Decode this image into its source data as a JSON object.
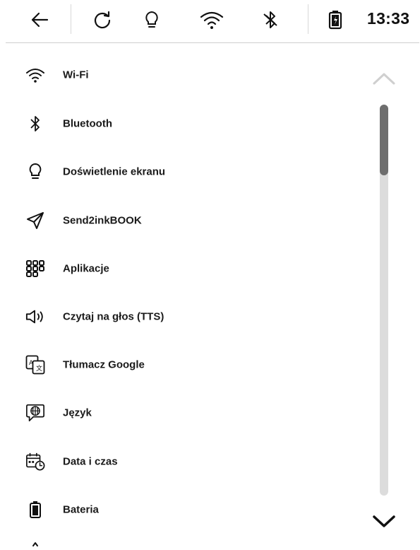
{
  "status_bar": {
    "time": "13:33",
    "icons": [
      "back-arrow-icon",
      "sync-icon",
      "lightbulb-icon",
      "wifi-icon",
      "bluetooth-off-icon",
      "battery-charging-icon"
    ]
  },
  "settings_menu": {
    "items": [
      {
        "label": "Wi-Fi",
        "icon": "wifi-icon"
      },
      {
        "label": "Bluetooth",
        "icon": "bluetooth-icon"
      },
      {
        "label": "Doświetlenie ekranu",
        "icon": "lightbulb-icon"
      },
      {
        "label": "Send2inkBOOK",
        "icon": "send-icon"
      },
      {
        "label": "Aplikacje",
        "icon": "apps-grid-icon"
      },
      {
        "label": "Czytaj na głos (TTS)",
        "icon": "speaker-icon"
      },
      {
        "label": "Tłumacz Google",
        "icon": "translate-icon"
      },
      {
        "label": "Język",
        "icon": "language-globe-icon"
      },
      {
        "label": "Data i czas",
        "icon": "calendar-clock-icon"
      },
      {
        "label": "Bateria",
        "icon": "battery-icon"
      }
    ]
  },
  "scrollbar": {
    "thumb_fraction": 0.18,
    "position_fraction": 0.0
  }
}
